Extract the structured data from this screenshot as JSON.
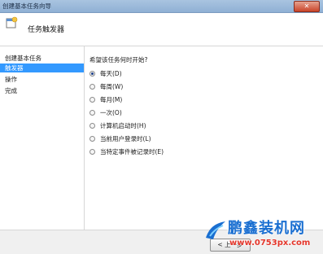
{
  "window": {
    "title": "创建基本任务向导",
    "close_label": "✕"
  },
  "header": {
    "title": "任务触发器",
    "icon": "wizard-icon"
  },
  "sidebar": {
    "items": [
      {
        "label": "创建基本任务",
        "selected": false
      },
      {
        "label": "触发器",
        "selected": true
      },
      {
        "label": "操作",
        "selected": false
      },
      {
        "label": "完成",
        "selected": false
      }
    ]
  },
  "main": {
    "question": "希望该任务何时开始?",
    "options": [
      {
        "label": "每天(D)",
        "checked": true
      },
      {
        "label": "每周(W)",
        "checked": false
      },
      {
        "label": "每月(M)",
        "checked": false
      },
      {
        "label": "一次(O)",
        "checked": false
      },
      {
        "label": "计算机启动时(H)",
        "checked": false
      },
      {
        "label": "当前用户登录时(L)",
        "checked": false
      },
      {
        "label": "当特定事件被记录时(E)",
        "checked": false
      }
    ]
  },
  "footer": {
    "back_label": "< 上一步"
  },
  "watermark": {
    "brand": "鹏鑫装机网",
    "url": "www.0753px.com"
  },
  "colors": {
    "selection": "#3399ff",
    "titlebar": "#a9c4e0"
  }
}
